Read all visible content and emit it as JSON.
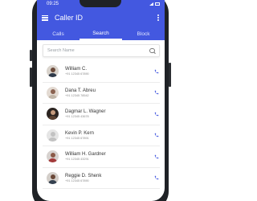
{
  "status_bar": {
    "time": "09:25"
  },
  "app_bar": {
    "title": "Caller ID",
    "menu_icon": "menu-icon",
    "more_icon": "more-vert-icon"
  },
  "tabs": [
    {
      "label": "Calls",
      "active": false
    },
    {
      "label": "Search",
      "active": true
    },
    {
      "label": "Block",
      "active": false
    }
  ],
  "search": {
    "placeholder": "Search Name",
    "value": ""
  },
  "contacts": [
    {
      "name": "William C.",
      "phone": "+91 12345 67890",
      "avatar_bg": "#d9d3cc",
      "avatar_head": "#6b4a3a",
      "avatar_body": "#2f3a4a"
    },
    {
      "name": "Dana T. Abreu",
      "phone": "+91 12345 78542",
      "avatar_bg": "#e3dad2",
      "avatar_head": "#8a6250",
      "avatar_body": "#c1b6a8"
    },
    {
      "name": "Dagmar L. Wagner",
      "phone": "+91 12345 43678",
      "avatar_bg": "#2c2420",
      "avatar_head": "#c79b7d",
      "avatar_body": "#5a4030"
    },
    {
      "name": "Kevin P. Kern",
      "phone": "+91 12345 67891",
      "avatar_bg": "#e5e5e5",
      "avatar_head": "#c2c2c2",
      "avatar_body": "#c2c2c2"
    },
    {
      "name": "William H. Gardner",
      "phone": "+91 12345 43291",
      "avatar_bg": "#d7d2cf",
      "avatar_head": "#8b5a48",
      "avatar_body": "#a33a3a"
    },
    {
      "name": "Reggie D. Shenk",
      "phone": "+91 12345 67890",
      "avatar_bg": "#d3cec9",
      "avatar_head": "#6a4838",
      "avatar_body": "#34404f"
    }
  ],
  "colors": {
    "primary": "#4358e0",
    "call_icon": "#4358e0"
  }
}
